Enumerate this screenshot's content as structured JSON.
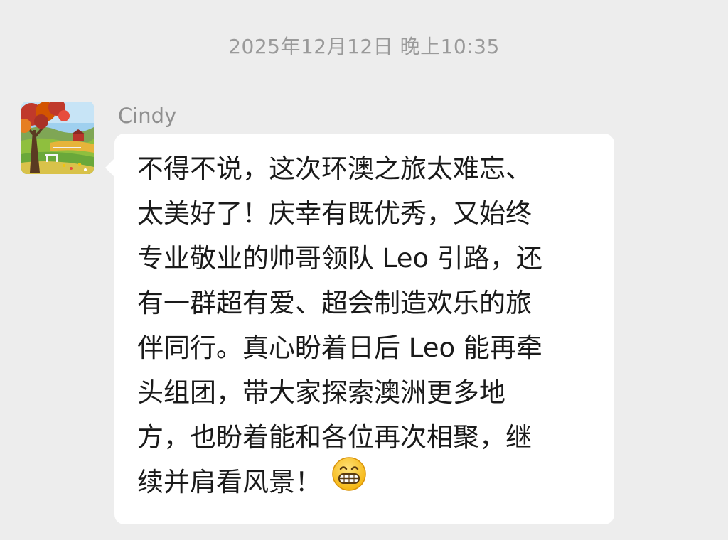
{
  "timestamp": "2025年12月12日 晚上10:35",
  "message": {
    "sender": "Cindy",
    "avatar_icon": "autumn-landscape-painting",
    "lines": [
      "不得不说，这次环澳之旅太难忘、",
      "太美好了！庆幸有既优秀，又始终",
      "专业敬业的帅哥领队 Leo 引路，还",
      "有一群超有爱、超会制造欢乐的旅",
      "伴同行。真心盼着日后 Leo 能再牵",
      "头组团，带大家探索澳洲更多地",
      "方，也盼着能和各位再次相聚，继",
      "续并肩看风景！"
    ],
    "emoji_icon": "grinning-face-icon"
  },
  "colors": {
    "background": "#ededed",
    "bubble": "#ffffff",
    "timestamp": "#9a9a9a",
    "sender": "#8f8f8f",
    "text": "#1a1a1a"
  }
}
